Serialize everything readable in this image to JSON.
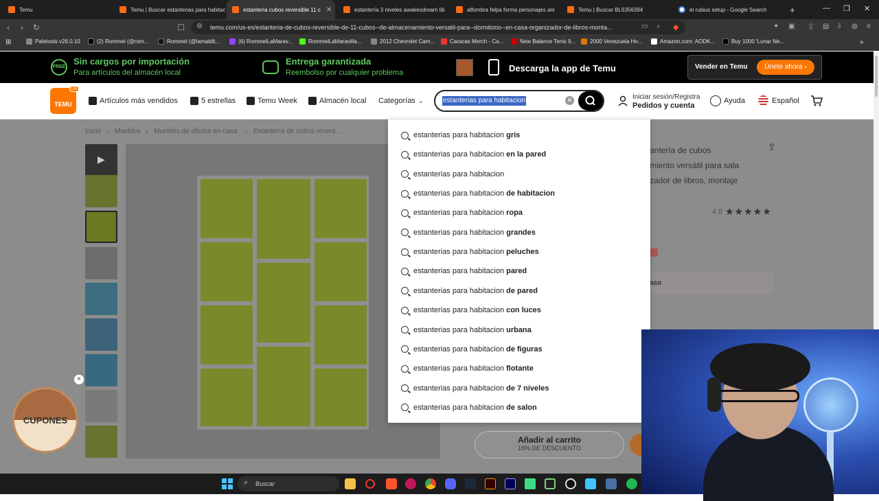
{
  "browser": {
    "tabs": [
      {
        "label": "Temu",
        "active": false
      },
      {
        "label": "Temu | Buscar estanterias para habitaci",
        "active": false
      },
      {
        "label": "estantería cubos reversible 11 c",
        "active": true
      },
      {
        "label": "estantería 3 niveles awakesdream lib",
        "active": false
      },
      {
        "label": "alfombra felpa forma personajes ani",
        "active": false
      },
      {
        "label": "Temu | Buscar BL6356394",
        "active": false
      },
      {
        "label": "el rubius setup - Google Search",
        "active": false
      }
    ],
    "new_tab": "+",
    "url": "temu.com/us-es/estanteria-de-cubos-reversible-de-11-cubos--de-almacenamiento-versatil-para--dormitorio--en-casa-organizador-de-libros-monta...",
    "bookmarks": [
      "Paletools v26.0.10",
      "(2) Rommel (@rom...",
      "Rommel (@lamaldit...",
      "(6) RommelLaMarav...",
      "RommelLaMaravilla...",
      "2012 Chevrolet Cam...",
      "Caracas Merch - Ca...",
      "New Balance Tenis 9...",
      "2000 Venezuela Ho...",
      "Amazon.com: AODK...",
      "Buy 1000 'Lunar Ne..."
    ]
  },
  "promo": {
    "free_badge": "FREE",
    "item1_title": "Sin cargos por importación",
    "item1_sub": "Para artículos del almacén local",
    "item2_title": "Entrega garantizada",
    "item2_sub": "Reembolso por cualquier problema",
    "app_download": "Descarga la app de Temu",
    "sell_label": "Vender en Temu",
    "join_label": "Únete ahora ›"
  },
  "header": {
    "logo_text": "TEMU",
    "logo_badge": "US",
    "nav": [
      "Artículos más vendidos",
      "5 estrellas",
      "Temu Week",
      "Almacén local",
      "Categorías"
    ],
    "search_value": "estanterias para habitacion",
    "signin_line1": "Iniciar sesión/Registra",
    "signin_line2": "Pedidos y cuenta",
    "help": "Ayuda",
    "language": "Español"
  },
  "breadcrumb": [
    "Inicio",
    "Muebles",
    "Muebles de oficina en casa",
    "Estantería de cubos revers..."
  ],
  "suggestions": [
    {
      "base": "estanterias para habitacion",
      "suffix": "gris"
    },
    {
      "base": "estanterias para habitacion",
      "suffix": "en la pared"
    },
    {
      "base": "estanterias para habitacion",
      "suffix": ""
    },
    {
      "base": "estanterias para habitacion",
      "suffix": "de habitacion"
    },
    {
      "base": "estanterias para habitacion",
      "suffix": "ropa"
    },
    {
      "base": "estanterias para habitacion",
      "suffix": "grandes"
    },
    {
      "base": "estanterias para habitacion",
      "suffix": "peluches"
    },
    {
      "base": "estanterias para habitacion",
      "suffix": "pared"
    },
    {
      "base": "estanterias para habitacion",
      "suffix": "de pared"
    },
    {
      "base": "estanterias para habitacion",
      "suffix": "con luces"
    },
    {
      "base": "estanterias para habitacion",
      "suffix": "urbana"
    },
    {
      "base": "estanterias para habitacion",
      "suffix": "de figuras"
    },
    {
      "base": "estanterias para habitacion",
      "suffix": "flotante"
    },
    {
      "base": "estanterias para habitacion",
      "suffix": "de 7 niveles"
    },
    {
      "base": "estanterias para habitacion",
      "suffix": "de salon"
    }
  ],
  "product": {
    "title_line1": "antería de cubos",
    "title_line2": "miento versátil para sala",
    "title_line3": "zador de libros, montaje",
    "rating": "4.8",
    "stars": "★★★★★",
    "promo_fragment": "aso",
    "cart_label": "Añadir al carrito",
    "cart_discount": "16% DE DESCUENTO"
  },
  "coupon": {
    "label": "CUPONES",
    "close": "×"
  },
  "taskbar": {
    "search": "Buscar"
  }
}
